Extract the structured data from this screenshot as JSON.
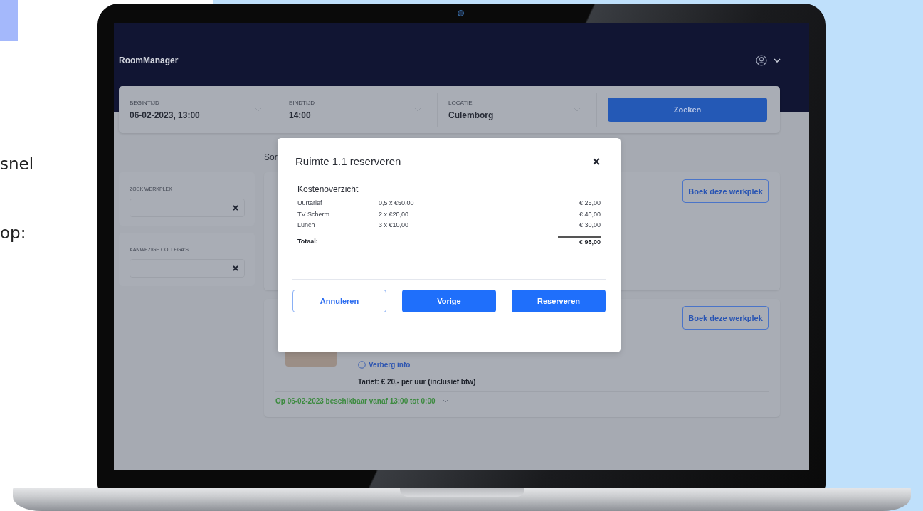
{
  "page": {
    "left_texts": [
      "snel",
      "op:"
    ]
  },
  "app": {
    "brand": "RoomManager",
    "search_fields": [
      {
        "label": "BEGINTIJD",
        "value": "06-02-2023, 13:00"
      },
      {
        "label": "EINDTIJD",
        "value": "14:00"
      },
      {
        "label": "LOCATIE",
        "value": "Culemborg"
      }
    ],
    "search_button": "Zoeken",
    "sidebar": [
      {
        "label": "ZOEK WERKPLEK"
      },
      {
        "label": "AANWEZIGE COLLEGA'S"
      }
    ],
    "sort_label": "Sor",
    "results": [
      {
        "book_button": "Boek deze werkplek"
      },
      {
        "book_button": "Boek deze werkplek",
        "info_link": "Verberg info",
        "tariff": "Tarief: € 20,- per uur (inclusief btw)",
        "availability": "Op 06-02-2023 beschikbaar vanaf 13:00 tot 0:00"
      }
    ]
  },
  "dialog": {
    "title": "Ruimte 1.1 reserveren",
    "section_title": "Kostenoverzicht",
    "rows": [
      {
        "label": "Uurtarief",
        "quantity": "0,5 x €50,00",
        "amount": "€ 25,00"
      },
      {
        "label": "TV Scherm",
        "quantity": "2 x €20,00",
        "amount": "€ 40,00"
      },
      {
        "label": "Lunch",
        "quantity": "3 x €10,00",
        "amount": "€ 30,00"
      }
    ],
    "total_label": "Totaal:",
    "total_amount": "€ 95,00",
    "buttons": [
      {
        "label": "Annuleren",
        "kind": "outline"
      },
      {
        "label": "Vorige",
        "kind": "primary"
      },
      {
        "label": "Reserveren",
        "kind": "primary"
      }
    ]
  }
}
